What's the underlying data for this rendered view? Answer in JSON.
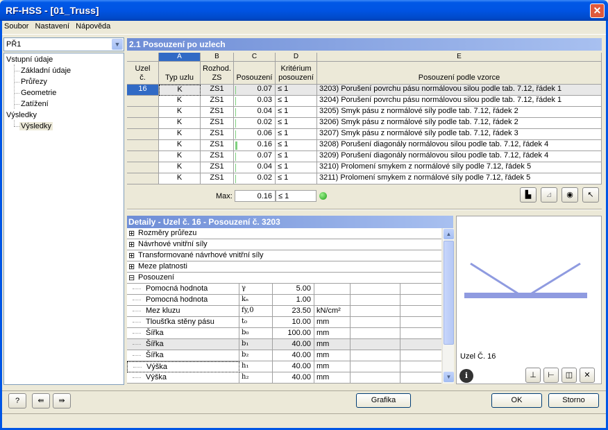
{
  "window": {
    "title": "RF-HSS - [01_Truss]",
    "close_icon": "close-icon"
  },
  "menu": [
    "Soubor",
    "Nastavení",
    "Nápověda"
  ],
  "case_combo": {
    "value": "PŘ1"
  },
  "tree": {
    "input_label": "Vstupní údaje",
    "input_items": [
      "Základní údaje",
      "Průřezy",
      "Geometrie",
      "Zatížení"
    ],
    "results_label": "Výsledky",
    "results_items": [
      "Výsledky"
    ]
  },
  "table": {
    "title": "2.1 Posouzení po uzlech",
    "col_letters": [
      "A",
      "B",
      "C",
      "D",
      "E"
    ],
    "headers": {
      "node": "Uzel\nč.",
      "type": "Typ uzlu",
      "zs": "Rozhod.\nZS",
      "check": "Posouzení",
      "crit": "Kritérium\nposouzení",
      "formula": "Posouzení podle vzorce"
    },
    "rows": [
      {
        "node": "16",
        "type": "K",
        "zs": "ZS1",
        "val": "0.07",
        "ratio": 0.07,
        "crit": "≤ 1",
        "formula": "3203) Porušení povrchu pásu normálovou silou podle tab. 7.12, řádek 1"
      },
      {
        "node": "",
        "type": "K",
        "zs": "ZS1",
        "val": "0.03",
        "ratio": 0.03,
        "crit": "≤ 1",
        "formula": "3204) Porušení povrchu pásu normálovou silou podle tab. 7.12, řádek 1"
      },
      {
        "node": "",
        "type": "K",
        "zs": "ZS1",
        "val": "0.04",
        "ratio": 0.04,
        "crit": "≤ 1",
        "formula": "3205) Smyk pásu z normálové síly podle tab. 7.12, řádek 2"
      },
      {
        "node": "",
        "type": "K",
        "zs": "ZS1",
        "val": "0.02",
        "ratio": 0.02,
        "crit": "≤ 1",
        "formula": "3206) Smyk pásu z normálové síly podle tab. 7.12, řádek 2"
      },
      {
        "node": "",
        "type": "K",
        "zs": "ZS1",
        "val": "0.06",
        "ratio": 0.06,
        "crit": "≤ 1",
        "formula": "3207) Smyk pásu z normálové síly podle tab. 7.12, řádek 3"
      },
      {
        "node": "",
        "type": "K",
        "zs": "ZS1",
        "val": "0.16",
        "ratio": 0.16,
        "crit": "≤ 1",
        "formula": "3208) Porušení diagonály normálovou silou podle tab. 7.12, řádek 4"
      },
      {
        "node": "",
        "type": "K",
        "zs": "ZS1",
        "val": "0.07",
        "ratio": 0.07,
        "crit": "≤ 1",
        "formula": "3209) Porušení diagonály normálovou silou podle tab. 7.12, řádek 4"
      },
      {
        "node": "",
        "type": "K",
        "zs": "ZS1",
        "val": "0.04",
        "ratio": 0.04,
        "crit": "≤ 1",
        "formula": "3210) Prolomení smykem z normálové síly podle 7.12, řádek 5"
      },
      {
        "node": "",
        "type": "K",
        "zs": "ZS1",
        "val": "0.02",
        "ratio": 0.02,
        "crit": "≤ 1",
        "formula": "3211) Prolomení smykem z normálové síly podle 7.12, řádek 5"
      }
    ],
    "max_label": "Max:",
    "max_value": "0.16",
    "max_crit": "≤ 1"
  },
  "details": {
    "title": "Detaily - Uzel č. 16 - Posouzení č. 3203",
    "groups": [
      "Rozměry průřezu",
      "Návrhové vnitřní síly",
      "Transformované návrhové vnitřní síly",
      "Meze platnosti"
    ],
    "open_group": "Posouzení",
    "rows": [
      {
        "name": "Pomocná hodnota",
        "sym": "γ",
        "val": "5.00",
        "unit": ""
      },
      {
        "name": "Pomocná hodnota",
        "sym": "kₙ",
        "val": "1.00",
        "unit": ""
      },
      {
        "name": "Mez kluzu",
        "sym": "fy,0",
        "val": "23.50",
        "unit": "kN/cm²"
      },
      {
        "name": "Tloušťka stěny pásu",
        "sym": "t₀",
        "val": "10.00",
        "unit": "mm"
      },
      {
        "name": "Šířka",
        "sym": "b₀",
        "val": "100.00",
        "unit": "mm"
      },
      {
        "name": "Šířka",
        "sym": "b₁",
        "val": "40.00",
        "unit": "mm"
      },
      {
        "name": "Šířka",
        "sym": "b₂",
        "val": "40.00",
        "unit": "mm"
      },
      {
        "name": "Výška",
        "sym": "h₁",
        "val": "40.00",
        "unit": "mm"
      },
      {
        "name": "Výška",
        "sym": "h₂",
        "val": "40.00",
        "unit": "mm"
      }
    ]
  },
  "preview": {
    "label": "Uzel Č. 16"
  },
  "buttons": {
    "grafika": "Grafika",
    "ok": "OK",
    "storno": "Storno"
  },
  "colors": {
    "accent": "#316ac5",
    "header_grad": "#6e8dd6",
    "bar": "#7fd07f"
  }
}
